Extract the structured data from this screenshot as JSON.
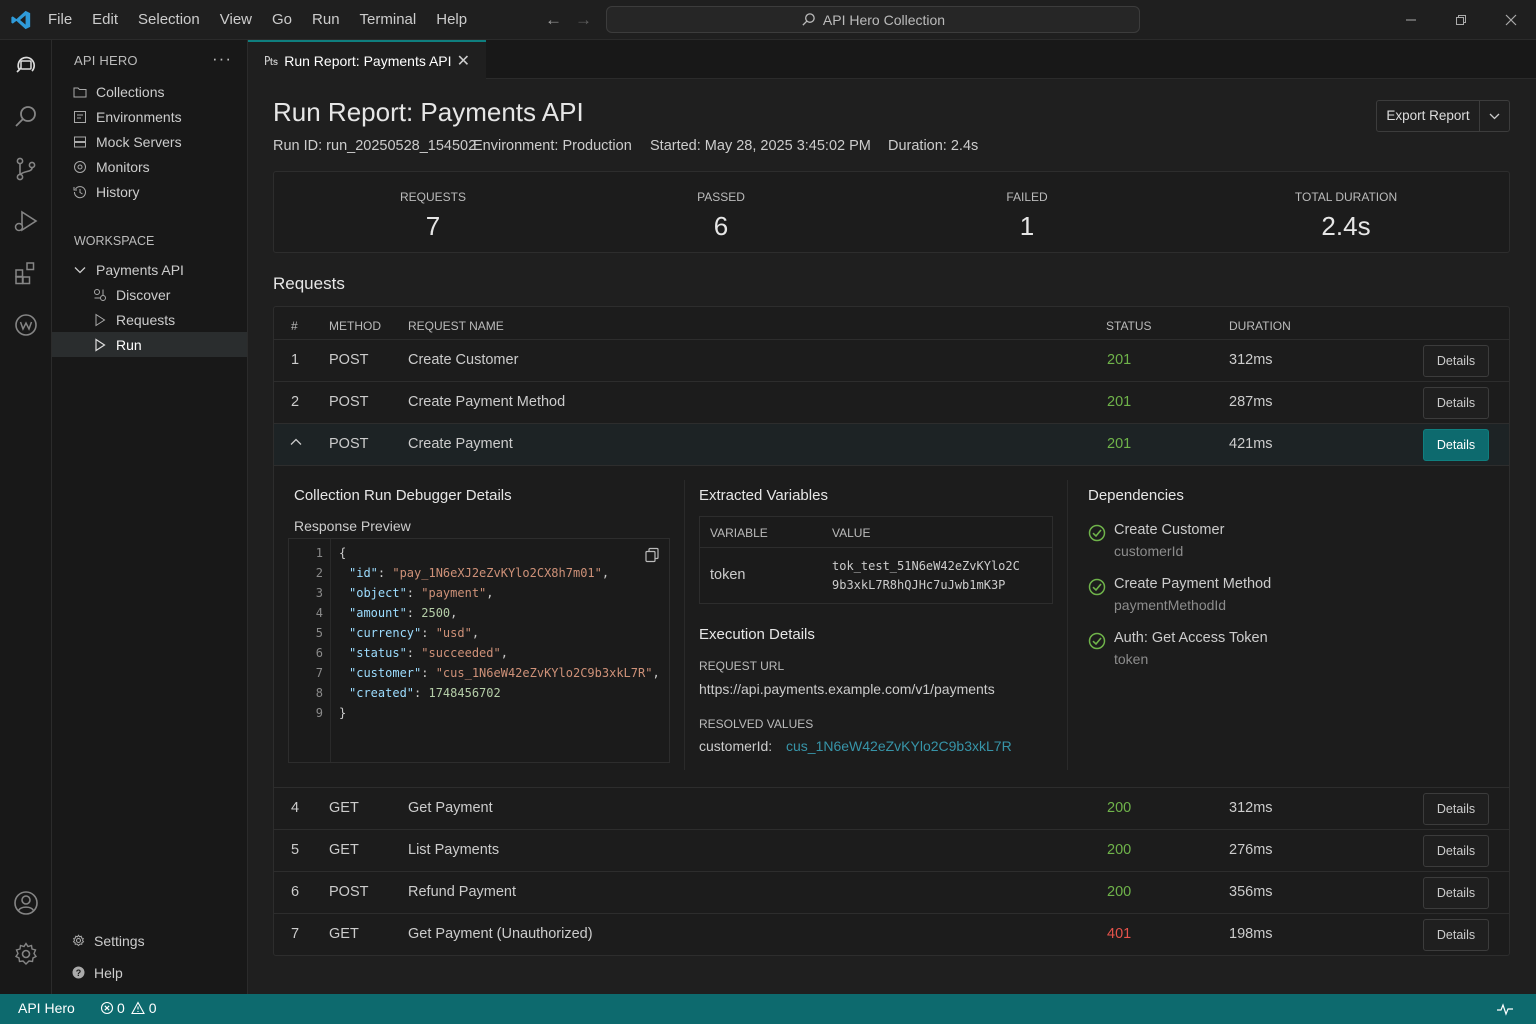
{
  "menu": [
    "File",
    "Edit",
    "Selection",
    "View",
    "Go",
    "Run",
    "Terminal",
    "Help"
  ],
  "search": {
    "text": "API Hero Collection"
  },
  "sidebar": {
    "title": "API HERO",
    "items": [
      {
        "label": "Collections",
        "icon": "folder-icon"
      },
      {
        "label": "Environments",
        "icon": "environment-icon"
      },
      {
        "label": "Mock Servers",
        "icon": "server-icon"
      },
      {
        "label": "Monitors",
        "icon": "monitor-icon"
      },
      {
        "label": "History",
        "icon": "history-icon"
      }
    ],
    "workspace_title": "WORKSPACE",
    "workspace": {
      "project": "Payments API",
      "children": [
        {
          "label": "Discover",
          "icon": "discover-icon"
        },
        {
          "label": "Requests",
          "icon": "play-outline-icon"
        },
        {
          "label": "Run",
          "icon": "play-icon",
          "active": true
        }
      ]
    },
    "footer": {
      "settings": "Settings",
      "help": "Help"
    }
  },
  "tab": {
    "label": "Run Report: Payments API",
    "icon": "filter-icon"
  },
  "report": {
    "title": "Run Report: Payments API",
    "run_id": "Run ID: run_20250528_154502",
    "environment": "Environment: Production",
    "started": "Started: May 28, 2025 3:45:02 PM",
    "duration": "Duration: 2.4s",
    "export_label": "Export Report"
  },
  "summary": {
    "requests": {
      "label": "REQUESTS",
      "value": "7"
    },
    "passed": {
      "label": "PASSED",
      "value": "6"
    },
    "failed": {
      "label": "FAILED",
      "value": "1"
    },
    "total": {
      "label": "TOTAL DURATION",
      "value": "2.4s"
    }
  },
  "requests_title": "Requests",
  "table": {
    "headers": {
      "num": "#",
      "method": "METHOD",
      "name": "REQUEST NAME",
      "status": "STATUS",
      "duration": "DURATION"
    },
    "details_label": "Details",
    "rows": [
      {
        "num": "1",
        "method": "POST",
        "name": "Create Customer",
        "status": "201",
        "duration": "312ms"
      },
      {
        "num": "2",
        "method": "POST",
        "name": "Create Payment Method",
        "status": "201",
        "duration": "287ms"
      },
      {
        "num": "",
        "method": "POST",
        "name": "Create Payment",
        "status": "201",
        "duration": "421ms"
      },
      {
        "num": "4",
        "method": "GET",
        "name": "Get Payment",
        "status": "200",
        "duration": "312ms"
      },
      {
        "num": "5",
        "method": "GET",
        "name": "List Payments",
        "status": "200",
        "duration": "276ms"
      },
      {
        "num": "6",
        "method": "POST",
        "name": "Refund Payment",
        "status": "200",
        "duration": "356ms"
      },
      {
        "num": "7",
        "method": "GET",
        "name": "Get Payment (Unauthorized)",
        "status": "401",
        "duration": "198ms"
      }
    ]
  },
  "debugger": {
    "title": "Collection Run Debugger Details",
    "response_preview": "Response Preview",
    "code": {
      "open": "{",
      "close": "}",
      "id_key": "\"id\"",
      "id_val": "\"pay_1N6eXJ2eZvKYlo2CX8h7m01\"",
      "object_key": "\"object\"",
      "object_val": "\"payment\"",
      "amount_key": "\"amount\"",
      "amount_val": "2500",
      "currency_key": "\"currency\"",
      "currency_val": "\"usd\"",
      "status_key": "\"status\"",
      "status_val": "\"succeeded\"",
      "customer_key": "\"customer\"",
      "customer_val": "\"cus_1N6eW42eZvKYlo2C9b3xkL7R\"",
      "created_key": "\"created\"",
      "created_val": "1748456702"
    },
    "extracted_title": "Extracted Variables",
    "var_header": "VARIABLE",
    "value_header": "VALUE",
    "var_name": "token",
    "var_value_1": "tok_test_51N6eW42eZvKYlo2C",
    "var_value_2": "9b3xkL7R8hQJHc7uJwb1mK3P",
    "execution_title": "Execution Details",
    "request_url_label": "REQUEST URL",
    "request_url": "https://api.payments.example.com/v1/payments",
    "resolved_label": "RESOLVED VALUES",
    "resolved_key": "customerId:",
    "resolved_value": "cus_1N6eW42eZvKYlo2C9b3xkL7R",
    "dependencies_title": "Dependencies",
    "dependencies": [
      {
        "name": "Create Customer",
        "var": "customerId"
      },
      {
        "name": "Create Payment Method",
        "var": "paymentMethodId"
      },
      {
        "name": "Auth: Get Access Token",
        "var": "token"
      }
    ]
  },
  "statusbar": {
    "app": "API Hero",
    "errors": "0",
    "warnings": "0"
  },
  "colors": {
    "accent": "#0d6a6e",
    "success": "#6fb34a",
    "error": "#e5534b",
    "link": "#3794a8"
  }
}
